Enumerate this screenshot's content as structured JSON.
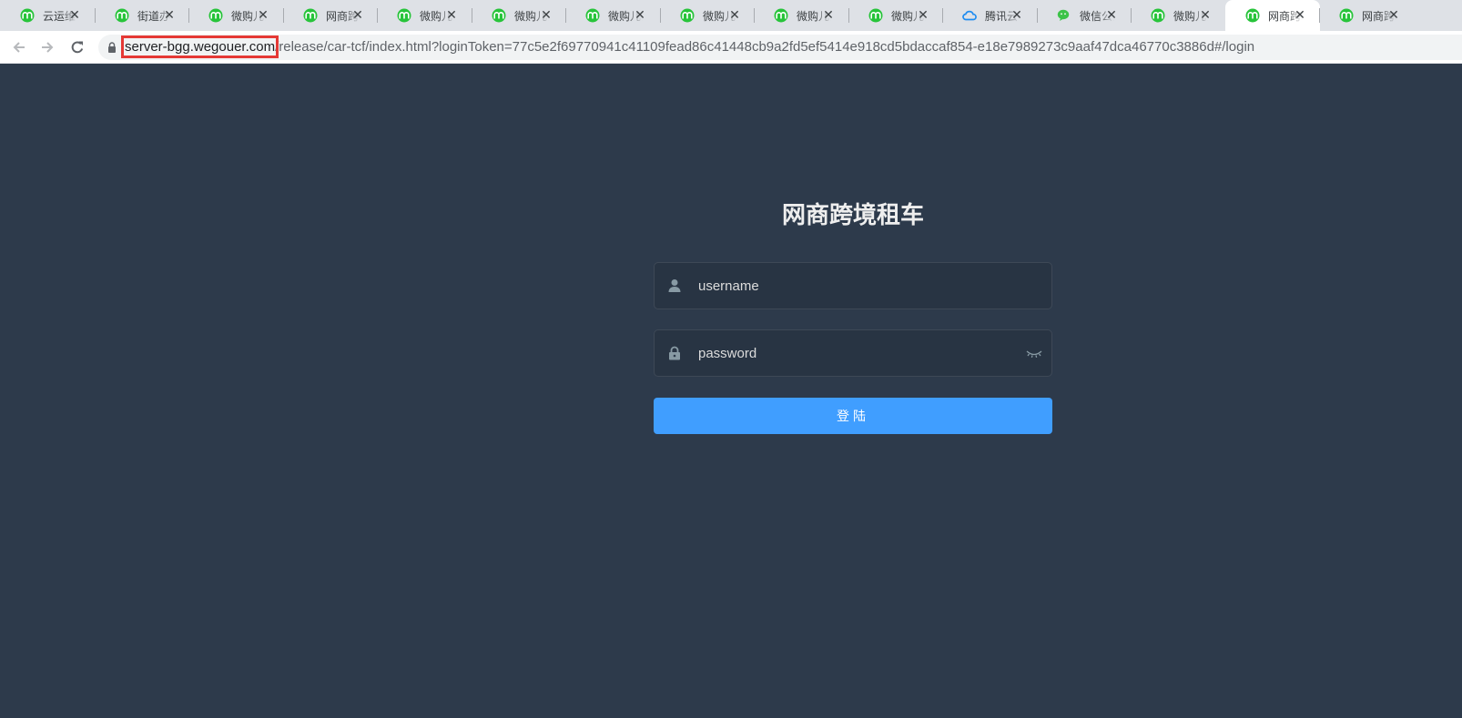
{
  "browser": {
    "tabs": [
      {
        "title": "云运维管理平台",
        "icon": "green-app-icon",
        "active": false
      },
      {
        "title": "街道办管理",
        "icon": "green-app-icon",
        "active": false
      },
      {
        "title": "微购儿云",
        "icon": "green-app-icon",
        "active": false
      },
      {
        "title": "网商跨境",
        "icon": "green-app-icon",
        "active": false
      },
      {
        "title": "微购儿云",
        "icon": "green-app-icon",
        "active": false
      },
      {
        "title": "微购儿云",
        "icon": "green-app-icon",
        "active": false
      },
      {
        "title": "微购儿云",
        "icon": "green-app-icon",
        "active": false
      },
      {
        "title": "微购儿云",
        "icon": "green-app-icon",
        "active": false
      },
      {
        "title": "微购儿云",
        "icon": "green-app-icon",
        "active": false
      },
      {
        "title": "微购儿云",
        "icon": "green-app-icon",
        "active": false
      },
      {
        "title": "腾讯云",
        "icon": "tencent-cloud-icon",
        "active": false
      },
      {
        "title": "微信公众",
        "icon": "wechat-icon",
        "active": false
      },
      {
        "title": "微购儿云",
        "icon": "green-app-icon",
        "active": false
      },
      {
        "title": "网商跨境",
        "icon": "green-app-icon",
        "active": true
      },
      {
        "title": "网商跨境",
        "icon": "green-app-icon",
        "active": false
      }
    ],
    "close_glyph": "✕",
    "url_host": "server-bgg.wegouer.com",
    "url_rest": "/release/car-tcf/index.html?loginToken=77c5e2f69770941c41109fead86c41448cb9a2fd5ef5414e918cd5bdaccaf854-e18e7989273c9aaf47dca46770c3886d#/login",
    "highlight_color": "#e53935"
  },
  "login": {
    "title": "网商跨境租车",
    "username_placeholder": "username",
    "password_placeholder": "password",
    "submit_label": "登陆",
    "accent_color": "#409eff",
    "background_color": "#2d3a4b"
  }
}
